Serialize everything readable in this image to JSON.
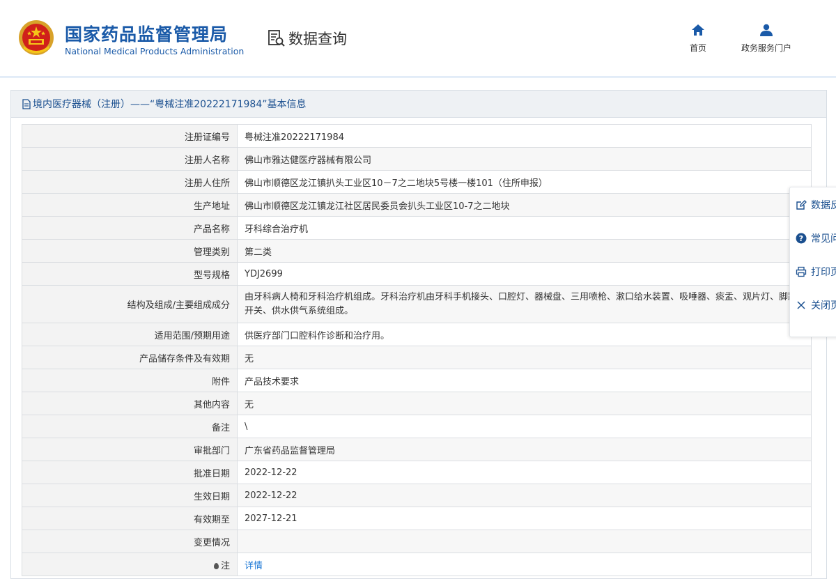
{
  "header": {
    "logo_cn": "国家药品监督管理局",
    "logo_en": "National Medical Products Administration",
    "query_title": "数据查询",
    "nav": [
      {
        "label": "首页",
        "icon": "home-icon"
      },
      {
        "label": "政务服务门户",
        "icon": "user-icon"
      }
    ]
  },
  "panel": {
    "title": "境内医疗器械（注册）——“粤械注准20222171984”基本信息"
  },
  "rows": [
    {
      "label": "注册证编号",
      "value": "粤械注准20222171984"
    },
    {
      "label": "注册人名称",
      "value": "佛山市雅达健医疗器械有限公司"
    },
    {
      "label": "注册人住所",
      "value": "佛山市顺德区龙江镇扒头工业区10－7之二地块5号楼一楼101（住所申报）"
    },
    {
      "label": "生产地址",
      "value": "佛山市顺德区龙江镇龙江社区居民委员会扒头工业区10-7之二地块"
    },
    {
      "label": "产品名称",
      "value": "牙科综合治疗机"
    },
    {
      "label": "管理类别",
      "value": "第二类"
    },
    {
      "label": "型号规格",
      "value": "YDJ2699"
    },
    {
      "label": "结构及组成/主要组成成分",
      "value": "由牙科病人椅和牙科治疗机组成。牙科治疗机由牙科手机接头、口腔灯、器械盘、三用喷枪、漱口给水装置、吸唾器、痰盂、观片灯、脚踏开关、供水供气系统组成。"
    },
    {
      "label": "适用范围/预期用途",
      "value": "供医疗部门口腔科作诊断和治疗用。"
    },
    {
      "label": "产品储存条件及有效期",
      "value": "无"
    },
    {
      "label": "附件",
      "value": "产品技术要求"
    },
    {
      "label": "其他内容",
      "value": "无"
    },
    {
      "label": "备注",
      "value": "\\"
    },
    {
      "label": "审批部门",
      "value": "广东省药品监督管理局"
    },
    {
      "label": "批准日期",
      "value": "2022-12-22"
    },
    {
      "label": "生效日期",
      "value": "2022-12-22"
    },
    {
      "label": "有效期至",
      "value": "2027-12-21"
    },
    {
      "label": "变更情况",
      "value": ""
    }
  ],
  "note_row": {
    "label": "注",
    "link": "详情"
  },
  "float_menu": [
    {
      "label": "数据反馈",
      "icon": "edit-icon"
    },
    {
      "label": "常见问题",
      "icon": "question-icon"
    },
    {
      "label": "打印页面",
      "icon": "print-icon"
    },
    {
      "label": "关闭页面",
      "icon": "close-icon"
    }
  ],
  "colors": {
    "brand_blue": "#1a5aa8",
    "link_blue": "#1f7ad6",
    "title_blue": "#1a4f8f"
  }
}
